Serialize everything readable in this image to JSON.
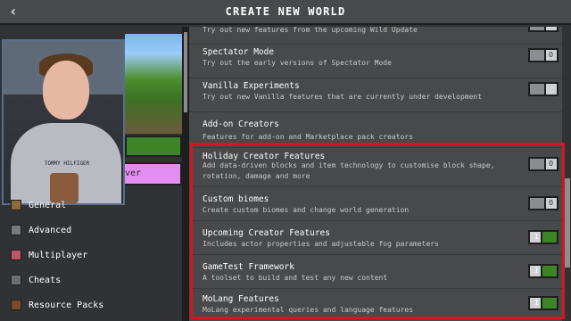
{
  "header": {
    "title": "CREATE NEW WORLD",
    "back_icon": "chevron-left-icon"
  },
  "left": {
    "server_label": "rver",
    "webcam_shirt_text": "TOMMY HILFIGER",
    "nav": [
      {
        "label": "General",
        "icon": "general-icon"
      },
      {
        "label": "Advanced",
        "icon": "advanced-icon"
      },
      {
        "label": "Multiplayer",
        "icon": "multiplayer-icon"
      },
      {
        "label": "Cheats",
        "icon": "cheats-icon"
      },
      {
        "label": "Resource Packs",
        "icon": "resource-packs-icon"
      }
    ]
  },
  "settings": [
    {
      "title": "",
      "desc": "Try out new features from the upcoming Wild Update",
      "state": "off"
    },
    {
      "title": "Spectator Mode",
      "desc": "Try out the early versions of Spectator Mode",
      "state": "off"
    },
    {
      "title": "Vanilla Experiments",
      "desc": "Try out new Vanilla features that are currently under development",
      "state": "off"
    },
    {
      "title": "Add-on Creators",
      "desc": "Features for add-on and Marketplace pack creators",
      "state": "none"
    },
    {
      "title": "Holiday Creator Features",
      "desc": "Add data-driven blocks and item technology to customise block shape, rotation, damage and more",
      "state": "off"
    },
    {
      "title": "Custom biomes",
      "desc": "Create custom biomes and change world generation",
      "state": "off"
    },
    {
      "title": "Upcoming Creator Features",
      "desc": "Includes actor properties and adjustable fog parameters",
      "state": "on"
    },
    {
      "title": "GameTest Framework",
      "desc": "A toolset to build and test any new content",
      "state": "on"
    },
    {
      "title": "MoLang Features",
      "desc": "MoLang experimental queries and language features",
      "state": "on"
    }
  ],
  "toggle_marks": {
    "on": "I",
    "off": "O"
  },
  "colors": {
    "highlight_border": "#d8141e",
    "toggle_on": "#3c8527",
    "server_button": "#e28ef0"
  }
}
